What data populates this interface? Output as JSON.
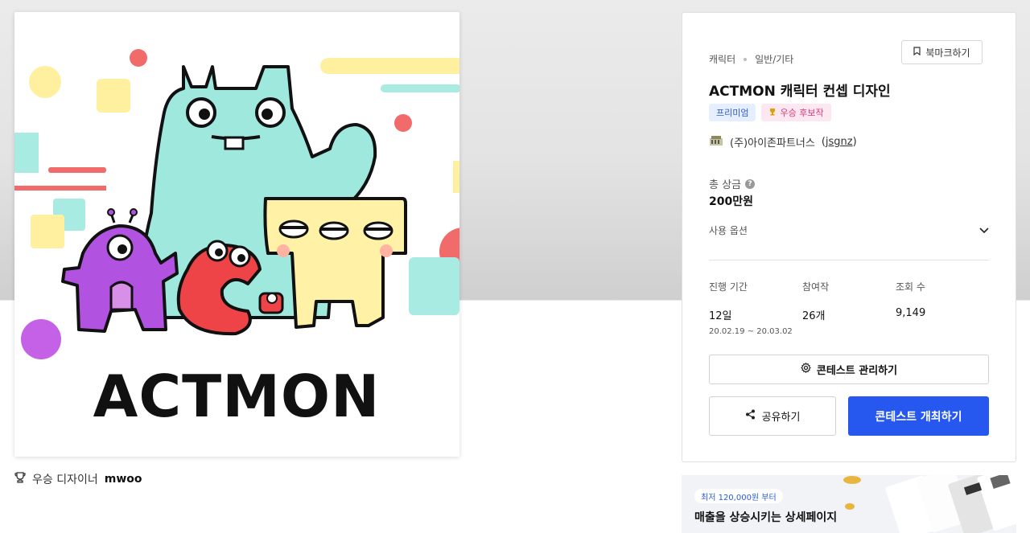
{
  "artwork": {
    "logo_text": "ACTMON"
  },
  "winner": {
    "label": "우승 디자이너",
    "name": "mwoo"
  },
  "contest": {
    "category": "캐릭터",
    "subcategory": "일반/기타",
    "bookmark_label": "북마크하기",
    "title": "ACTMON 캐릭터 컨셉 디자인",
    "badges": {
      "premium": "프리미엄",
      "award": "우승 후보작"
    },
    "host_name": "(주)아이존파트너스",
    "host_handle": "jsgnz",
    "prize_label": "총 상금",
    "prize_value": "200만원",
    "usage_label": "사용 옵션",
    "stats": {
      "period_label": "진행 기간",
      "period_value": "12일",
      "period_range": "20.02.19 ~ 20.03.02",
      "participants_label": "참여작",
      "participants_value": "26개",
      "views_label": "조회 수",
      "views_value": "9,149"
    },
    "manage_label": "콘테스트 관리하기",
    "share_label": "공유하기",
    "host_contest_label": "콘테스트 개최하기"
  },
  "ad": {
    "price_pill": "최저 120,000원 부터",
    "headline": "매출을 상승시키는 상세페이지"
  },
  "colors": {
    "primary": "#2658f0",
    "premium_bg": "#e6efff",
    "award_bg": "#fde8f1",
    "monster_mint": "#9ee8de",
    "monster_purple": "#b153e0",
    "monster_red": "#ee4448",
    "monster_yellow": "#fff1a6"
  },
  "icons": {
    "bookmark": "bookmark-icon",
    "help": "question-icon",
    "chevron": "chevron-down-icon",
    "gear": "gear-icon",
    "share": "share-icon",
    "trophy": "trophy-icon"
  }
}
